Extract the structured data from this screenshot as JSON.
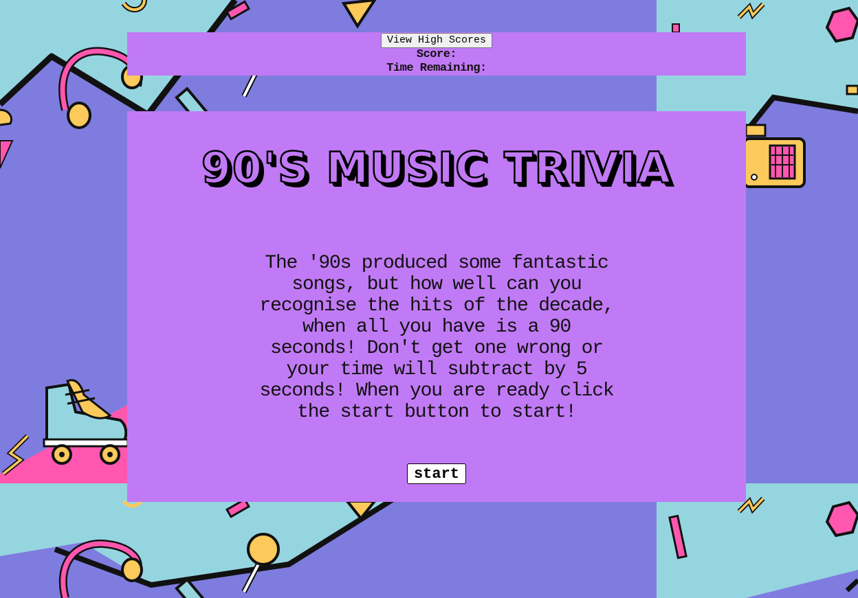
{
  "header": {
    "high_scores_label": "View High Scores",
    "score_label": "Score:",
    "time_label": "Time Remaining:"
  },
  "main": {
    "title": "90'S MUSIC TRIVIA",
    "description": "The '90s produced some fantastic songs, but how well can you recognise the hits of the decade, when all you have is a 90 seconds! Don't get one wrong or your time will subtract by 5 seconds! When you are ready click the start button to start!",
    "start_label": "start"
  },
  "background": {
    "icons": [
      "headphones-icon",
      "lollipop-icon",
      "roller-skate-icon",
      "boombox-icon",
      "hexagon-icon",
      "zigzag-icon",
      "triangle-icon"
    ]
  },
  "colors": {
    "panel": "#c17af5",
    "background_teal": "#95d5e0",
    "background_purple": "#7f7cdf",
    "accent_pink": "#ff57b0",
    "accent_yellow": "#fcc95b"
  }
}
